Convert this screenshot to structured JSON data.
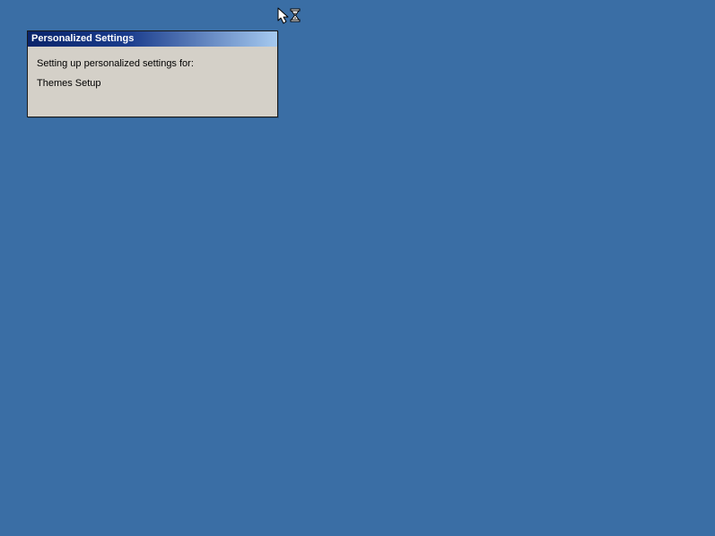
{
  "desktop": {
    "background_color": "#3a6ea5"
  },
  "dialog": {
    "title": "Personalized Settings",
    "message_line1": "Setting up personalized settings for:",
    "message_line2": "Themes Setup"
  },
  "cursor": {
    "state": "busy-arrow-hourglass"
  }
}
